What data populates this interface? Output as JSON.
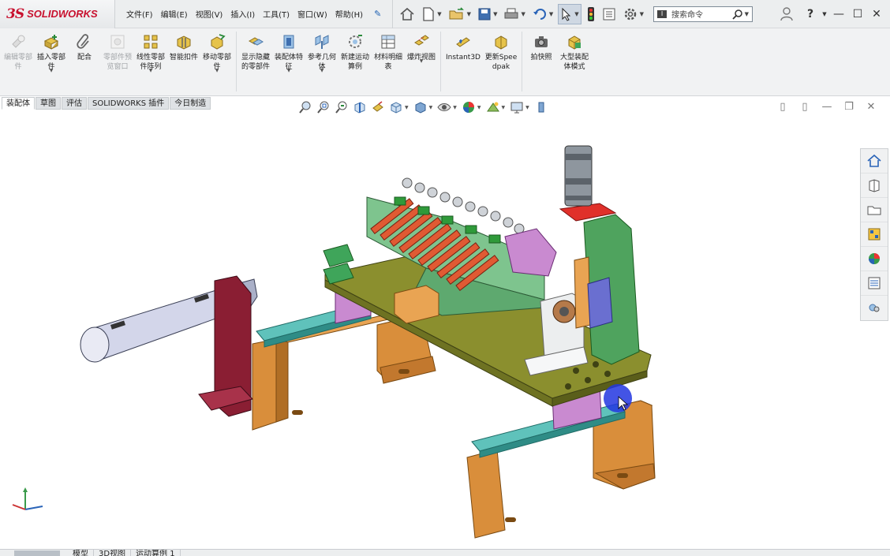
{
  "app": {
    "logo_ds": "3S",
    "logo_brand": "SOLIDWORKS"
  },
  "menus": [
    "文件(F)",
    "编辑(E)",
    "视图(V)",
    "插入(I)",
    "工具(T)",
    "窗口(W)",
    "帮助(H)"
  ],
  "search": {
    "prefix": "I",
    "placeholder": "搜索命令"
  },
  "ribbon": {
    "buttons": [
      {
        "label": "编辑零部件",
        "disabled": true
      },
      {
        "label": "插入零部件",
        "disabled": false,
        "dropdown": true
      },
      {
        "label": "配合",
        "disabled": false
      },
      {
        "label": "零部件预览窗口",
        "disabled": true
      },
      {
        "label": "线性零部件阵列",
        "disabled": false,
        "dropdown": true
      },
      {
        "label": "智能扣件",
        "disabled": false
      },
      {
        "label": "移动零部件",
        "disabled": false,
        "dropdown": true
      },
      {
        "label": "显示隐藏的零部件",
        "disabled": false
      },
      {
        "label": "装配体特征",
        "disabled": false,
        "dropdown": true
      },
      {
        "label": "参考几何体",
        "disabled": false,
        "dropdown": true
      },
      {
        "label": "新建运动算例",
        "disabled": false
      },
      {
        "label": "材料明细表",
        "disabled": false
      },
      {
        "label": "爆炸视图",
        "disabled": false,
        "dropdown": true
      },
      {
        "label": "Instant3D",
        "disabled": false
      },
      {
        "label": "更新Speedpak",
        "disabled": false
      },
      {
        "label": "拍快照",
        "disabled": false
      },
      {
        "label": "大型装配体模式",
        "disabled": false
      }
    ]
  },
  "command_tabs": [
    "装配体",
    "草图",
    "评估",
    "SOLIDWORKS 插件",
    "今日制造"
  ],
  "active_command_tab": 0,
  "bottom_tabs": [
    "模型",
    "3D视图",
    "运动算例 1"
  ],
  "colors": {
    "accent": "#1c5fb2",
    "brand_red": "#c8102e",
    "frame_orange": "#d98e3b",
    "plate_olive": "#8b8f2e",
    "rail_teal": "#3aa6a0",
    "cylinder_red": "#e05a33",
    "bracket_maroon": "#8a1e33",
    "cursor_highlight": "#2236e0"
  },
  "icons": {
    "titlebar": [
      "home-icon",
      "new-document-icon",
      "open-icon",
      "save-icon",
      "print-icon",
      "undo-icon",
      "select-icon",
      "traffic-light-icon",
      "file-properties-icon",
      "options-gear-icon",
      "user-icon",
      "help-icon"
    ],
    "hud": [
      "zoom-to-fit-icon",
      "zoom-area-icon",
      "previous-view-icon",
      "section-view-icon",
      "dynamic-annotation-icon",
      "view-orientation-icon",
      "display-style-icon",
      "hide-show-icon",
      "edit-appearance-icon",
      "apply-scene-icon",
      "view-settings-icon",
      "rotate-icon"
    ],
    "task_pane": [
      "home-icon",
      "design-library-icon",
      "file-explorer-icon",
      "view-palette-icon",
      "appearances-icon",
      "custom-properties-icon",
      "solidworks-forum-icon"
    ]
  }
}
